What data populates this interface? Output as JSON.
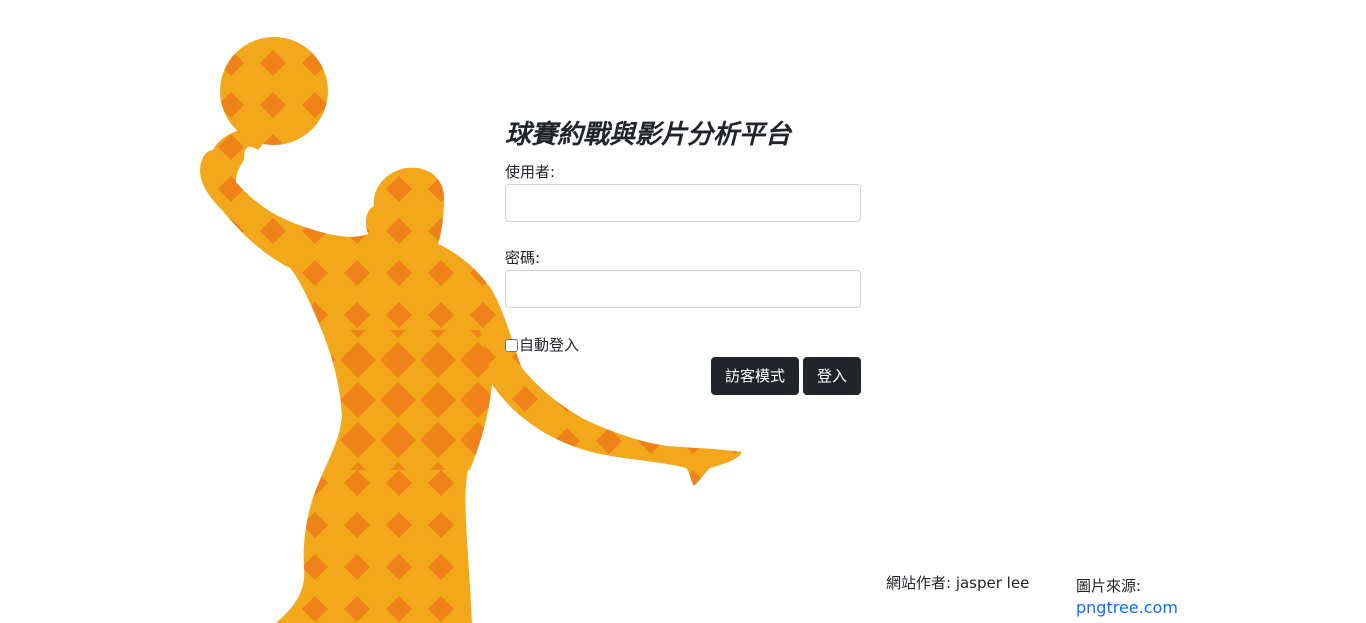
{
  "title": "球賽約戰與影片分析平台",
  "form": {
    "username_label": "使用者:",
    "username_value": "",
    "password_label": "密碼:",
    "password_value": "",
    "remember_label": "自動登入",
    "remember_checked": false
  },
  "buttons": {
    "guest_label": "訪客模式",
    "login_label": "登入"
  },
  "credits": {
    "author_label": "網站作者: jasper lee",
    "source_label": "圖片來源:",
    "source_link": "pngtree.com"
  },
  "colors": {
    "silhouette": "#f3a81c",
    "pattern": "#ee8118",
    "button": "#212529",
    "link": "#0d6efd"
  },
  "graphic": "basketball-player-silhouette"
}
